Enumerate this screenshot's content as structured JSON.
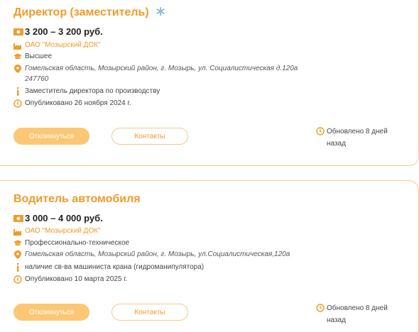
{
  "colors": {
    "accent": "#f09b2a",
    "button_fill": "#fcc774",
    "border": "#f6c98a"
  },
  "vacancies": [
    {
      "title": "Директор (заместитель)",
      "title_icon": "snowflake-icon",
      "salary": "3 200 – 3 200 руб.",
      "company": "ОАО \"Мозырский ДОК\"",
      "education": "Высшее",
      "address_line1": "Гомельская область, Мозырский район, г. Мозырь, ул. Социалистическая д.120а",
      "address_line2": "247760",
      "description": "Заместитель директора по производству",
      "published": "Опубликовано 26 ноября 2024 г.",
      "apply_label": "Откликнуться",
      "contacts_label": "Контакты",
      "updated": "Обновлено 8 дней назад"
    },
    {
      "title": "Водитель автомобиля",
      "salary": "3 000 – 4 000 руб.",
      "company": "ОАО \"Мозырский ДОК\"",
      "education": "Профессионально-техническое",
      "address_line1": "Гомельская область, Мозырский район, г. Мозырь, ул.Социалистическая,120а",
      "description": "наличие св-ва машиниста крана (гидроманипулятора)",
      "published": "Опубликовано 10 марта 2025 г.",
      "apply_label": "Откликнуться",
      "contacts_label": "Контакты",
      "updated": "Обновлено 8 дней назад"
    }
  ]
}
